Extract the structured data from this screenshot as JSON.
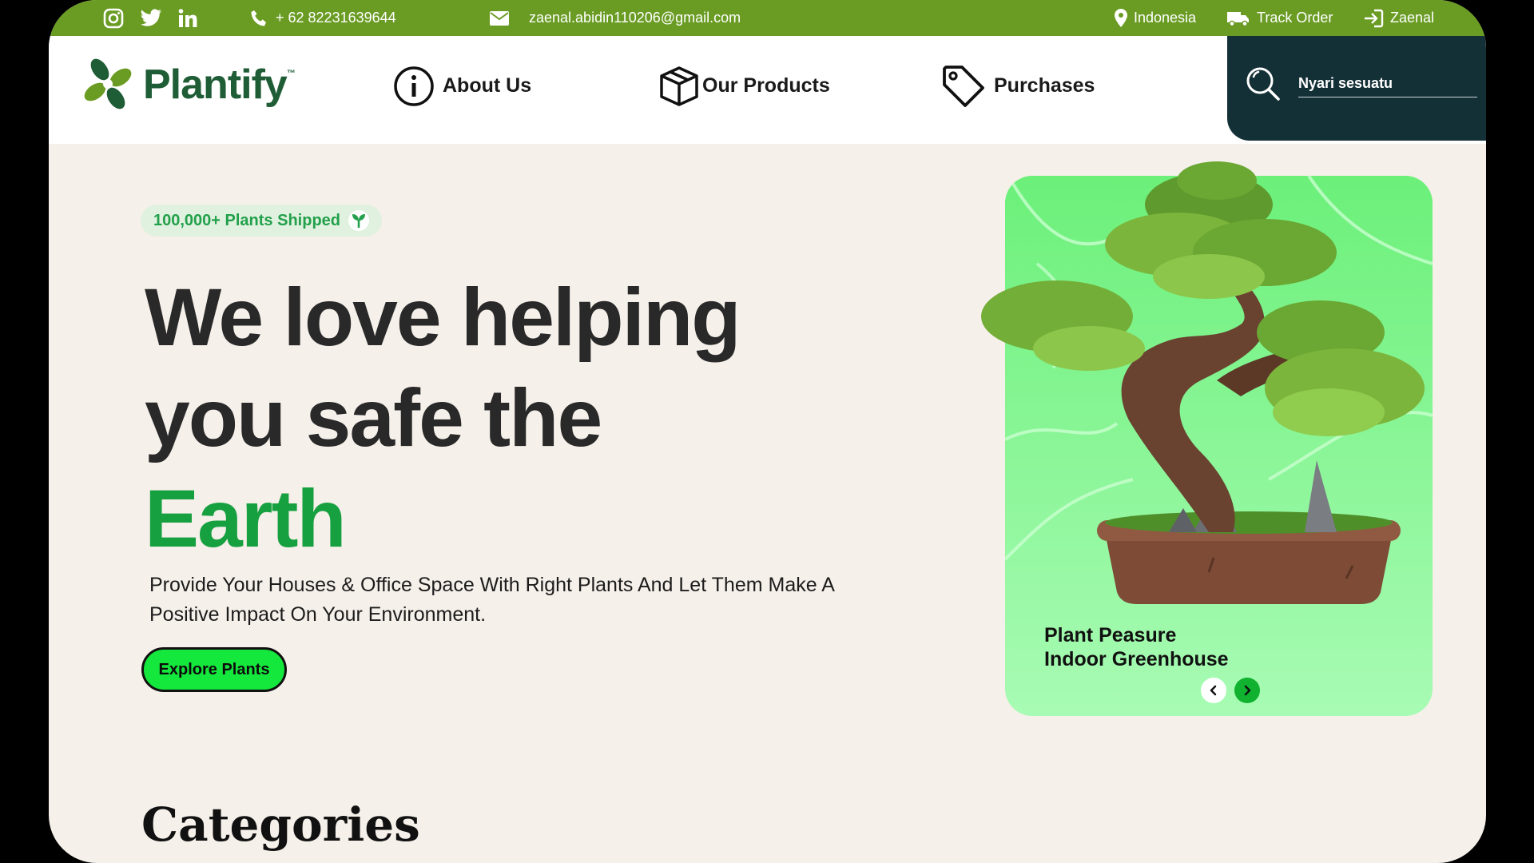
{
  "topbar": {
    "phone": "+ 62 82231639644",
    "email": "zaenal.abidin110206@gmail.com",
    "country": "Indonesia",
    "track_order": "Track Order",
    "user": "Zaenal",
    "social_icons": [
      "instagram-icon",
      "twitter-icon",
      "linkedin-icon"
    ]
  },
  "header": {
    "logo": "Plantify",
    "logo_tm": "™",
    "nav": [
      "About Us",
      "Our Products",
      "Purchases"
    ],
    "search_placeholder": "Nyari sesuatu"
  },
  "hero": {
    "badge": "100,000+ Plants Shipped",
    "headline_line1": "We love helping",
    "headline_line2": "you safe the",
    "headline_green": "Earth",
    "subtext": "Provide Your Houses & Office Space With Right Plants And Let Them Make A Positive Impact On Your Environment.",
    "cta": "Explore Plants"
  },
  "card": {
    "title_line1": "Plant Peasure",
    "title_line2": "Indoor Greenhouse",
    "prev_icon": "chevron-left-icon",
    "next_icon": "chevron-right-icon"
  },
  "section": {
    "categories_title": "Categories"
  },
  "colors": {
    "topbar": "#6a9c24",
    "brand_green": "#1e5d35",
    "accent_green": "#17a040",
    "cta": "#15e83c",
    "search_bg": "#143037",
    "page_bg": "#f6f0ea"
  }
}
